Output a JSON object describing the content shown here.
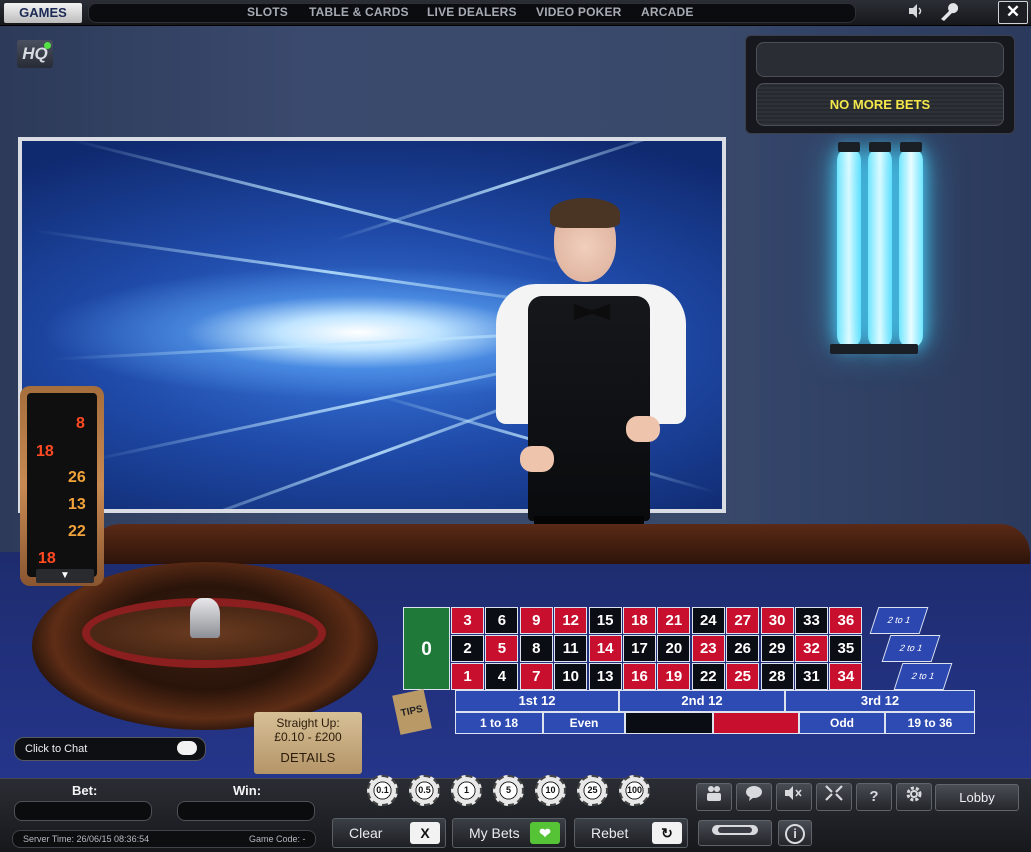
{
  "topbar": {
    "games_label": "GAMES",
    "nav": [
      "SLOTS",
      "TABLE & CARDS",
      "LIVE DEALERS",
      "VIDEO POKER",
      "ARCADE"
    ],
    "close_label": "✕",
    "sound_icon": "speaker-icon",
    "settings_icon": "wrench-icon"
  },
  "badge": {
    "hq_label": "HQ"
  },
  "status": {
    "top_text": "",
    "message": "NO MORE BETS",
    "message_color": "#f5e84a"
  },
  "history": {
    "results": [
      {
        "value": "8",
        "color": "red"
      },
      {
        "value": "18",
        "color": "red"
      },
      {
        "value": "26",
        "color": "black"
      },
      {
        "value": "13",
        "color": "black"
      },
      {
        "value": "22",
        "color": "black"
      },
      {
        "value": "18",
        "color": "red"
      }
    ],
    "arrow": "▼"
  },
  "board": {
    "zero": "0",
    "rows": [
      [
        {
          "n": "3",
          "c": "red"
        },
        {
          "n": "6",
          "c": "black"
        },
        {
          "n": "9",
          "c": "red"
        },
        {
          "n": "12",
          "c": "red"
        },
        {
          "n": "15",
          "c": "black"
        },
        {
          "n": "18",
          "c": "red"
        },
        {
          "n": "21",
          "c": "red"
        },
        {
          "n": "24",
          "c": "black"
        },
        {
          "n": "27",
          "c": "red"
        },
        {
          "n": "30",
          "c": "red"
        },
        {
          "n": "33",
          "c": "black"
        },
        {
          "n": "36",
          "c": "red"
        }
      ],
      [
        {
          "n": "2",
          "c": "black"
        },
        {
          "n": "5",
          "c": "red"
        },
        {
          "n": "8",
          "c": "black"
        },
        {
          "n": "11",
          "c": "black"
        },
        {
          "n": "14",
          "c": "red"
        },
        {
          "n": "17",
          "c": "black"
        },
        {
          "n": "20",
          "c": "black"
        },
        {
          "n": "23",
          "c": "red"
        },
        {
          "n": "26",
          "c": "black"
        },
        {
          "n": "29",
          "c": "black"
        },
        {
          "n": "32",
          "c": "red"
        },
        {
          "n": "35",
          "c": "black"
        }
      ],
      [
        {
          "n": "1",
          "c": "red"
        },
        {
          "n": "4",
          "c": "black"
        },
        {
          "n": "7",
          "c": "red"
        },
        {
          "n": "10",
          "c": "black"
        },
        {
          "n": "13",
          "c": "black"
        },
        {
          "n": "16",
          "c": "red"
        },
        {
          "n": "19",
          "c": "red"
        },
        {
          "n": "22",
          "c": "black"
        },
        {
          "n": "25",
          "c": "red"
        },
        {
          "n": "28",
          "c": "black"
        },
        {
          "n": "31",
          "c": "black"
        },
        {
          "n": "34",
          "c": "red"
        }
      ]
    ],
    "column_bets": [
      "2 to 1",
      "2 to 1",
      "2 to 1"
    ],
    "dozens": [
      "1st 12",
      "2nd 12",
      "3rd 12"
    ],
    "outside": {
      "low": "1 to 18",
      "even": "Even",
      "red": "",
      "black": "",
      "odd": "Odd",
      "high": "19 to 36"
    },
    "tips": "TIPS"
  },
  "limits": {
    "title": "Straight Up:",
    "range": "£0.10 - £200",
    "details": "DETAILS"
  },
  "chat": {
    "label": "Click to Chat"
  },
  "bottom": {
    "bet_label": "Bet:",
    "win_label": "Win:",
    "server_time": "Server Time: 26/06/15 08:36:54",
    "game_code": "Game Code: -"
  },
  "chips": [
    "0.1",
    "0.5",
    "1",
    "5",
    "10",
    "25",
    "100"
  ],
  "actions": {
    "clear": "Clear",
    "clear_icon": "X",
    "my_bets": "My Bets",
    "my_bets_icon": "❤",
    "rebet": "Rebet",
    "rebet_icon": "↻"
  },
  "tools": {
    "players": "players-icon",
    "chat": "chat-bubble-icon",
    "mute": "mute-icon",
    "fullscreen": "fullscreen-icon",
    "help": "?",
    "settings": "gear-icon",
    "info": "i",
    "lobby": "Lobby"
  }
}
